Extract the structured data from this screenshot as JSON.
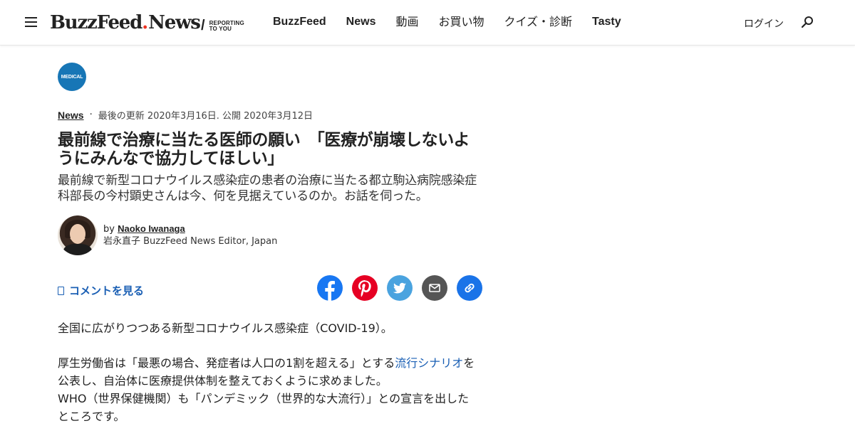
{
  "header": {
    "logo_text": "BuzzFeed",
    "logo_news": "News",
    "logo_tagline_1": "REPORTING",
    "logo_tagline_2": "TO YOU",
    "nav": [
      "BuzzFeed",
      "News",
      "動画",
      "お買い物",
      "クイズ・診断",
      "Tasty"
    ],
    "login": "ログイン"
  },
  "badge": {
    "label": "MEDICAL",
    "color": "#1776b6"
  },
  "meta": {
    "category": "News",
    "separator": "·",
    "dates": "最後の更新 2020年3月16日. 公開 2020年3月12日"
  },
  "headline": "最前線で治療に当たる医師の願い　「医療が崩壊しないようにみんなで協力してほしい」",
  "dek": "最前線で新型コロナウイルス感染症の患者の治療に当たる都立駒込病院感染症科部長の今村顕史さんは今、何を見据えているのか。お話を伺った。",
  "byline": {
    "by": "by",
    "name": "Naoko Iwanaga",
    "role": "岩永直子 BuzzFeed News Editor, Japan"
  },
  "comments_label": "コメントを見る",
  "share": [
    {
      "name": "facebook-icon",
      "color": "#1877f2"
    },
    {
      "name": "pinterest-icon",
      "color": "#e60023"
    },
    {
      "name": "twitter-icon",
      "color": "#1da1f2"
    },
    {
      "name": "email-icon",
      "color": "#555555"
    },
    {
      "name": "link-icon",
      "color": "#1a73e8"
    }
  ],
  "body": {
    "p1": "全国に広がりつつある新型コロナウイルス感染症（COVID-19）。",
    "p2_before": "厚生労働省は「最悪の場合、発症者は人口の1割を超える」とする",
    "p2_link": "流行シナリオ",
    "p2_after": "を公表し、自治体に医療提供体制を整えておくように求めました。",
    "p3": "WHO（世界保健機関）も「パンデミック（世界的な大流行）」との宣言を出したところです。"
  }
}
